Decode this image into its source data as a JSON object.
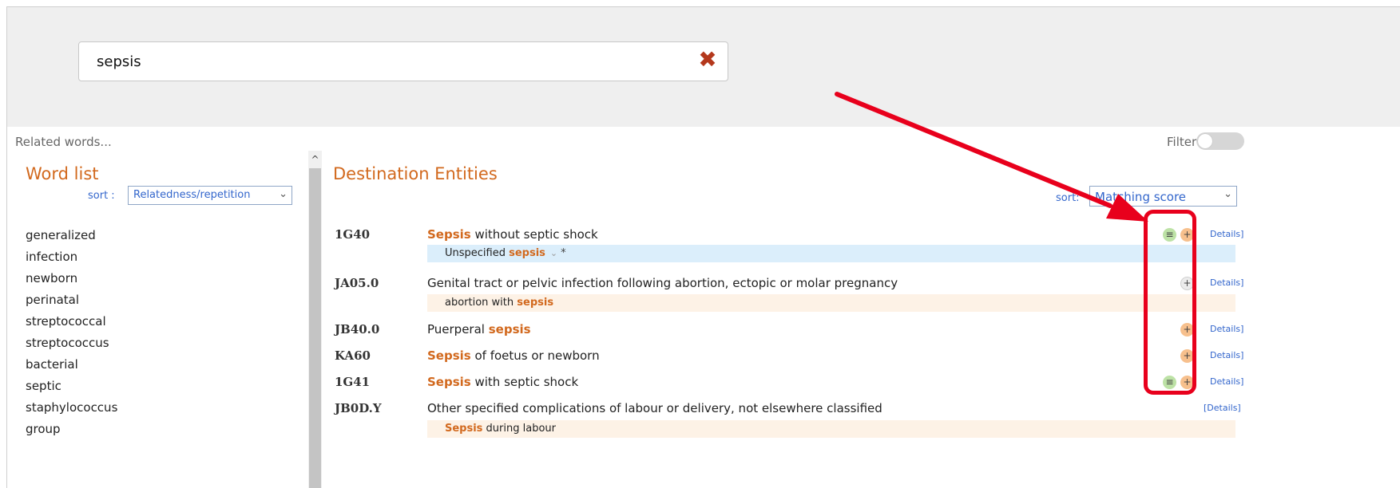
{
  "search": {
    "value": "sepsis",
    "clear_icon": "close-icon"
  },
  "related_words_label": "Related words...",
  "filter": {
    "label": "Filter",
    "enabled": false
  },
  "word_list": {
    "title": "Word list",
    "sort_label": "sort :",
    "sort_value": "Relatedness/repetition",
    "items": [
      "generalized",
      "infection",
      "newborn",
      "perinatal",
      "streptococcal",
      "streptococcus",
      "bacterial",
      "septic",
      "staphylococcus",
      "group"
    ]
  },
  "destination": {
    "title": "Destination Entities",
    "sort_label": "sort:",
    "sort_value": "Matching score",
    "details_label": "Details]",
    "details_label_full": "[Details]",
    "entities": [
      {
        "code": "1G40",
        "title_hl": "Sepsis",
        "title_rest": " without septic shock",
        "sub_pre": "Unspecified ",
        "sub_hl": "sepsis",
        "sub_post": ""
      },
      {
        "code": "JA05.0",
        "title": "Genital tract or pelvic infection following abortion, ectopic or molar pregnancy",
        "sub_pre": "abortion with ",
        "sub_hl": "sepsis"
      },
      {
        "code": "JB40.0",
        "title_pre": "Puerperal ",
        "title_hl": "sepsis"
      },
      {
        "code": "KA60",
        "title_hl": "Sepsis",
        "title_rest": " of foetus or newborn"
      },
      {
        "code": "1G41",
        "title_hl": "Sepsis",
        "title_rest": " with septic shock"
      },
      {
        "code": "JB0D.Y",
        "title": "Other specified complications of labour or delivery, not elsewhere classified",
        "sub_hl": "Sepsis",
        "sub_post": " during labour"
      }
    ]
  },
  "annotation": {
    "color": "#e8001c"
  },
  "colors": {
    "accent": "#d2691e",
    "link": "#3366cc",
    "highlight_blue": "#dbeefb",
    "highlight_peach": "#fdf2e6"
  }
}
